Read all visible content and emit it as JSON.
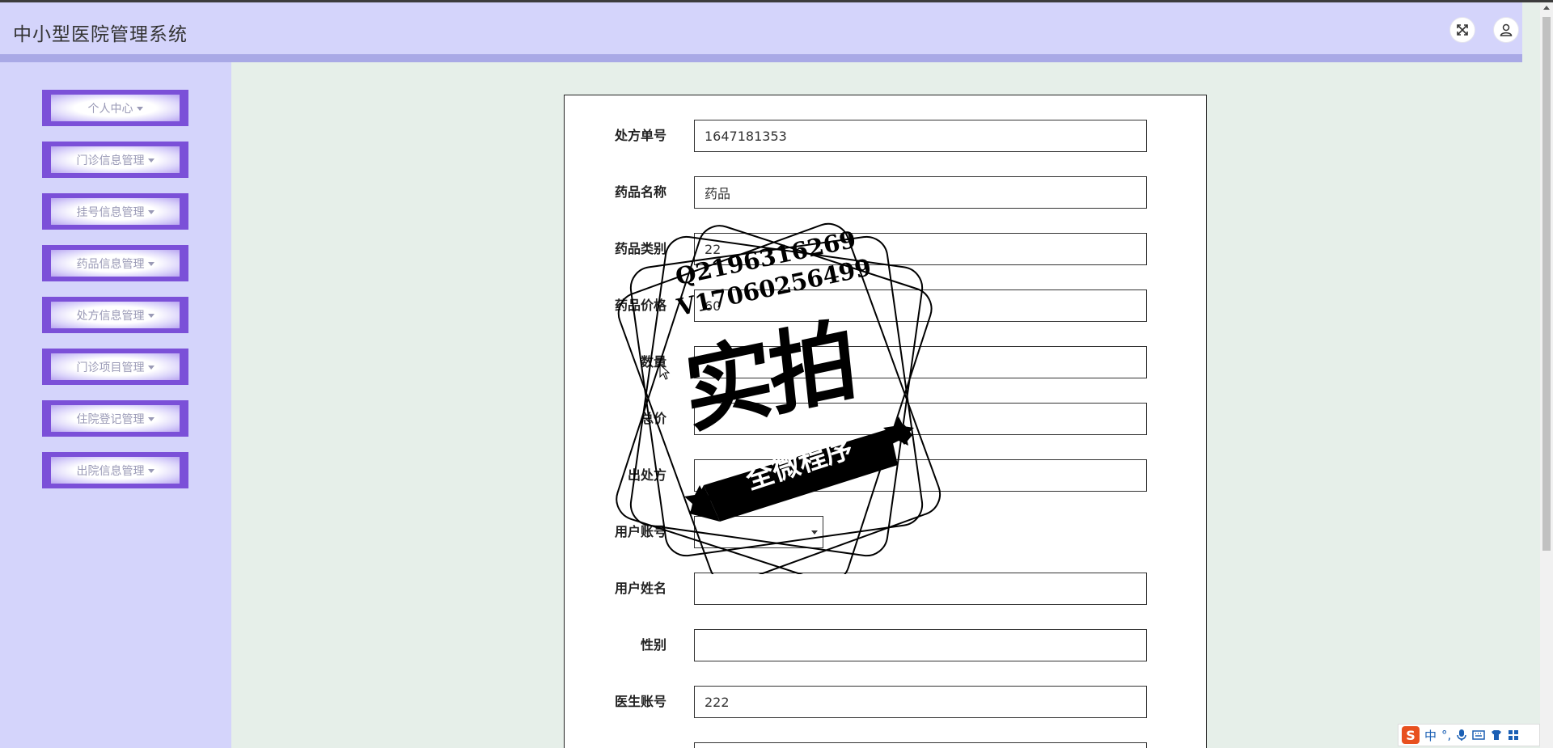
{
  "header": {
    "title": "中小型医院管理系统",
    "icons": [
      "fullscreen-icon",
      "user-icon"
    ]
  },
  "sidebar": {
    "items": [
      {
        "label": "个人中心"
      },
      {
        "label": "门诊信息管理"
      },
      {
        "label": "挂号信息管理"
      },
      {
        "label": "药品信息管理"
      },
      {
        "label": "处方信息管理"
      },
      {
        "label": "门诊项目管理"
      },
      {
        "label": "住院登记管理"
      },
      {
        "label": "出院信息管理"
      }
    ]
  },
  "form": {
    "fields": [
      {
        "label": "处方单号",
        "value": "1647181353",
        "type": "input"
      },
      {
        "label": "药品名称",
        "value": "药品",
        "type": "input"
      },
      {
        "label": "药品类别",
        "value": "22",
        "type": "input"
      },
      {
        "label": "药品价格",
        "value": "60",
        "type": "input"
      },
      {
        "label": "数量",
        "value": "",
        "type": "input"
      },
      {
        "label": "总价",
        "value": "",
        "type": "input"
      },
      {
        "label": "出处方",
        "value": "",
        "type": "input"
      },
      {
        "label": "用户账号",
        "value": "",
        "type": "select"
      },
      {
        "label": "用户姓名",
        "value": "",
        "type": "input"
      },
      {
        "label": "性别",
        "value": "",
        "type": "input"
      },
      {
        "label": "医生账号",
        "value": "222",
        "type": "input"
      }
    ]
  },
  "watermark": {
    "line1": "Q2196316269",
    "line2": "V17060256499",
    "big": "实拍",
    "banner": "全微程序"
  },
  "ime": {
    "logo": "S",
    "mode": "中",
    "punct": "°,"
  },
  "colors": {
    "header_bg": "#d4d4fb",
    "menu_accent": "#7b50d8",
    "content_bg": "#e6efe9"
  }
}
